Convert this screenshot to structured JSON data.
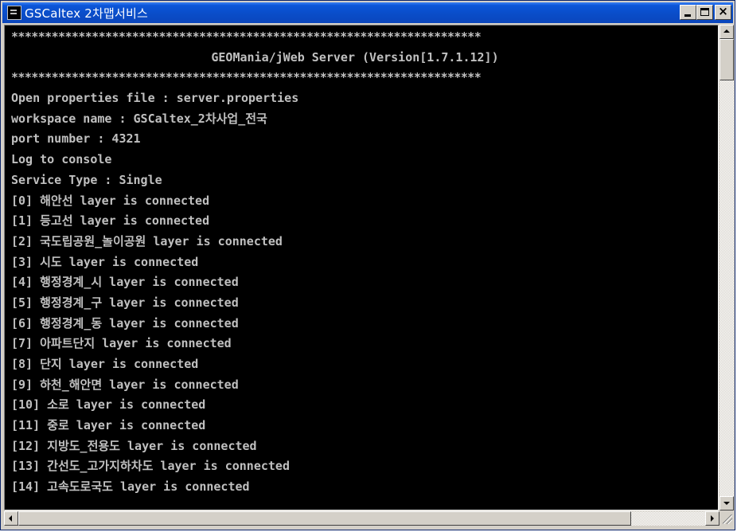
{
  "window": {
    "title": "GSCaltex  2차맵서비스",
    "icon": "console-app-icon",
    "buttons": {
      "minimize": "minimize",
      "maximize": "maximize",
      "close": "×"
    }
  },
  "console": {
    "stars_top": "**********************************************************************",
    "header": "GEOMania/jWeb Server (Version[1.7.1.12])",
    "stars_bottom": "**********************************************************************",
    "lines": [
      "Open properties file : server.properties",
      "workspace name : GSCaltex_2차사업_전국",
      "port number : 4321",
      "Log to console",
      "Service Type : Single",
      "[0] 해안선 layer is connected",
      "[1] 등고선 layer is connected",
      "[2] 국도립공원_놀이공원 layer is connected",
      "[3] 시도 layer is connected",
      "[4] 행정경계_시 layer is connected",
      "[5] 행정경계_구 layer is connected",
      "[6] 행정경계_동 layer is connected",
      "[7] 아파트단지 layer is connected",
      "[8] 단지 layer is connected",
      "[9] 하천_해안면 layer is connected",
      "[10] 소로 layer is connected",
      "[11] 중로 layer is connected",
      "[12] 지방도_전용도 layer is connected",
      "[13] 간선도_고가지하차도 layer is connected",
      "[14] 고속도로국도 layer is connected"
    ]
  }
}
